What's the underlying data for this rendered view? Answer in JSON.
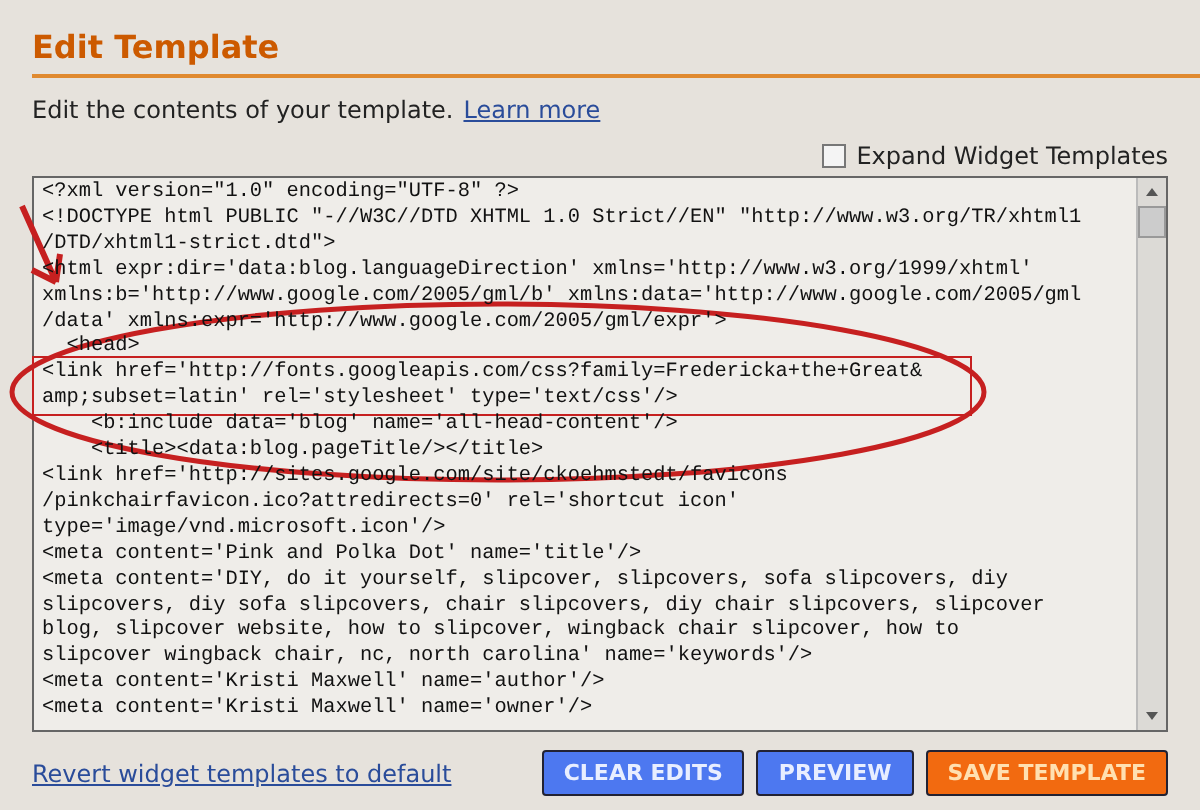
{
  "title": "Edit Template",
  "description": {
    "text": "Edit the contents of your template.",
    "link": "Learn more"
  },
  "expand_widget_templates": {
    "label": "Expand Widget Templates",
    "checked": false
  },
  "code_lines": [
    "<?xml version=\"1.0\" encoding=\"UTF-8\" ?>",
    "<!DOCTYPE html PUBLIC \"-//W3C//DTD XHTML 1.0 Strict//EN\" \"http://www.w3.org/TR/xhtml1",
    "/DTD/xhtml1-strict.dtd\">",
    "<html expr:dir='data:blog.languageDirection' xmlns='http://www.w3.org/1999/xhtml'",
    "xmlns:b='http://www.google.com/2005/gml/b' xmlns:data='http://www.google.com/2005/gml",
    "/data' xmlns:expr='http://www.google.com/2005/gml/expr'>",
    "  <head>",
    "<link href='http://fonts.googleapis.com/css?family=Fredericka+the+Great&",
    "amp;subset=latin' rel='stylesheet' type='text/css'/>",
    "    <b:include data='blog' name='all-head-content'/>",
    "    <title><data:blog.pageTitle/></title>",
    "<link href='http://sites.google.com/site/ckoehmstedt/favicons",
    "/pinkchairfavicon.ico?attredirects=0' rel='shortcut icon'",
    "type='image/vnd.microsoft.icon'/>",
    "<meta content='Pink and Polka Dot' name='title'/>",
    "<meta content='DIY, do it yourself, slipcover, slipcovers, sofa slipcovers, diy",
    "slipcovers, diy sofa slipcovers, chair slipcovers, diy chair slipcovers, slipcover",
    "blog, slipcover website, how to slipcover, wingback chair slipcover, how to",
    "slipcover wingback chair, nc, north carolina' name='keywords'/>",
    "<meta content='Kristi Maxwell' name='author'/>",
    "<meta content='Kristi Maxwell' name='owner'/>"
  ],
  "revert_link": "Revert widget templates to default",
  "buttons": [
    {
      "label": "CLEAR EDITS",
      "kind": "secondary"
    },
    {
      "label": "PREVIEW",
      "kind": "secondary"
    },
    {
      "label": "SAVE TEMPLATE",
      "kind": "primary"
    }
  ]
}
